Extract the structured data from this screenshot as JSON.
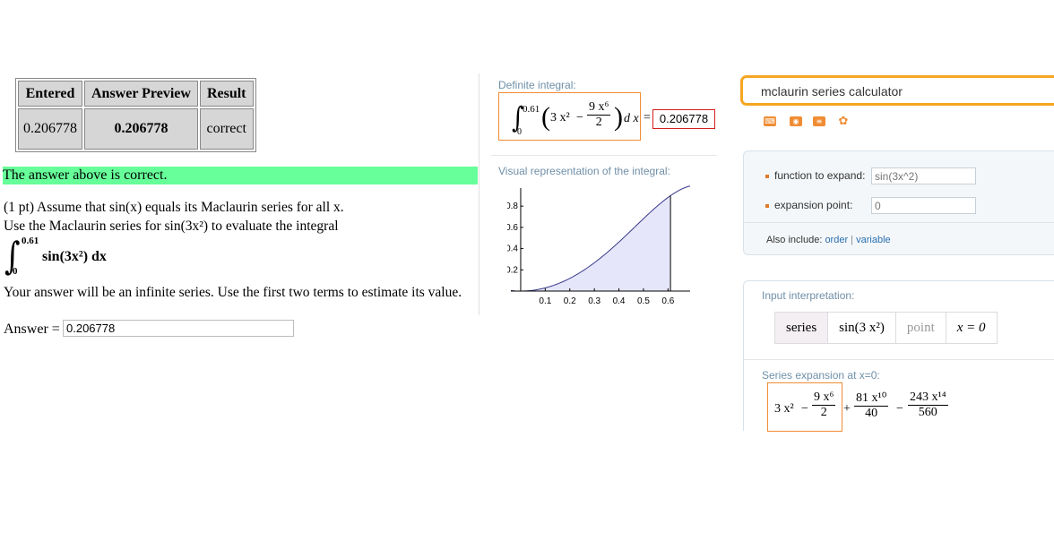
{
  "webwork": {
    "table": {
      "headers": [
        "Entered",
        "Answer Preview",
        "Result"
      ],
      "row": [
        "0.206778",
        "0.206778",
        "correct"
      ]
    },
    "status": "The answer above is correct.",
    "problem": {
      "line1": "(1 pt) Assume that sin(x) equals its Maclaurin series for all x.",
      "line2": "Use the Maclaurin series for sin(3x²) to evaluate the integral",
      "integral_upper": "0.61",
      "integral_lower": "0",
      "integrand": "sin(3x²) dx",
      "line3": "Your answer will be an infinite series. Use the first two terms to estimate its value."
    },
    "answer_label": "Answer =",
    "answer_value": "0.206778"
  },
  "wolfram": {
    "definite_label": "Definite integral:",
    "integral": {
      "upper": "0.61",
      "lower": "0",
      "term1": "3 x²",
      "minus": "−",
      "frac_num": "9 x⁶",
      "frac_den": "2",
      "dx": "d x",
      "equals": "=",
      "result": "0.206778"
    },
    "visual_label": "Visual representation of the integral:",
    "search_query": "mclaurin series calculator",
    "tool_icons": [
      "keyboard-icon",
      "camera-icon",
      "table-icon",
      "random-icon"
    ],
    "expand": {
      "function_label": "function to expand:",
      "function_placeholder": "sin(3x^2)",
      "point_label": "expansion point:",
      "point_placeholder": "0",
      "also_include": "Also include:",
      "link_order": "order",
      "link_sep": " | ",
      "link_variable": "variable"
    },
    "input_interpretation_label": "Input interpretation:",
    "interpretation": [
      "series",
      "sin(3 x²)",
      "point",
      "x = 0"
    ],
    "series_label": "Series expansion at x=0:",
    "series": {
      "t1": "3 x²",
      "minus1": "−",
      "f1_num": "9 x⁶",
      "f1_den": "2",
      "plus": "+",
      "f2_num": "81 x¹⁰",
      "f2_den": "40",
      "minus2": "−",
      "f3_num": "243 x¹⁴",
      "f3_den": "560"
    },
    "colors": {
      "accent": "#f08c33",
      "search_border": "#f5a623",
      "result_border": "#d02020",
      "label": "#6f8fa8",
      "fill": "#e6e6fa",
      "correct": "#66ff99"
    }
  },
  "chart_data": {
    "type": "area",
    "function": "sin(3x^2)",
    "x_ticks": [
      "0.1",
      "0.2",
      "0.3",
      "0.4",
      "0.5",
      "0.6"
    ],
    "y_ticks": [
      "0.2",
      "0.4",
      "0.6",
      "0.8"
    ],
    "xlim": [
      -0.04,
      0.69
    ],
    "ylim": [
      0,
      0.97
    ],
    "fill_range": [
      0,
      0.61
    ],
    "curve_range": [
      -0.04,
      0.69
    ]
  }
}
